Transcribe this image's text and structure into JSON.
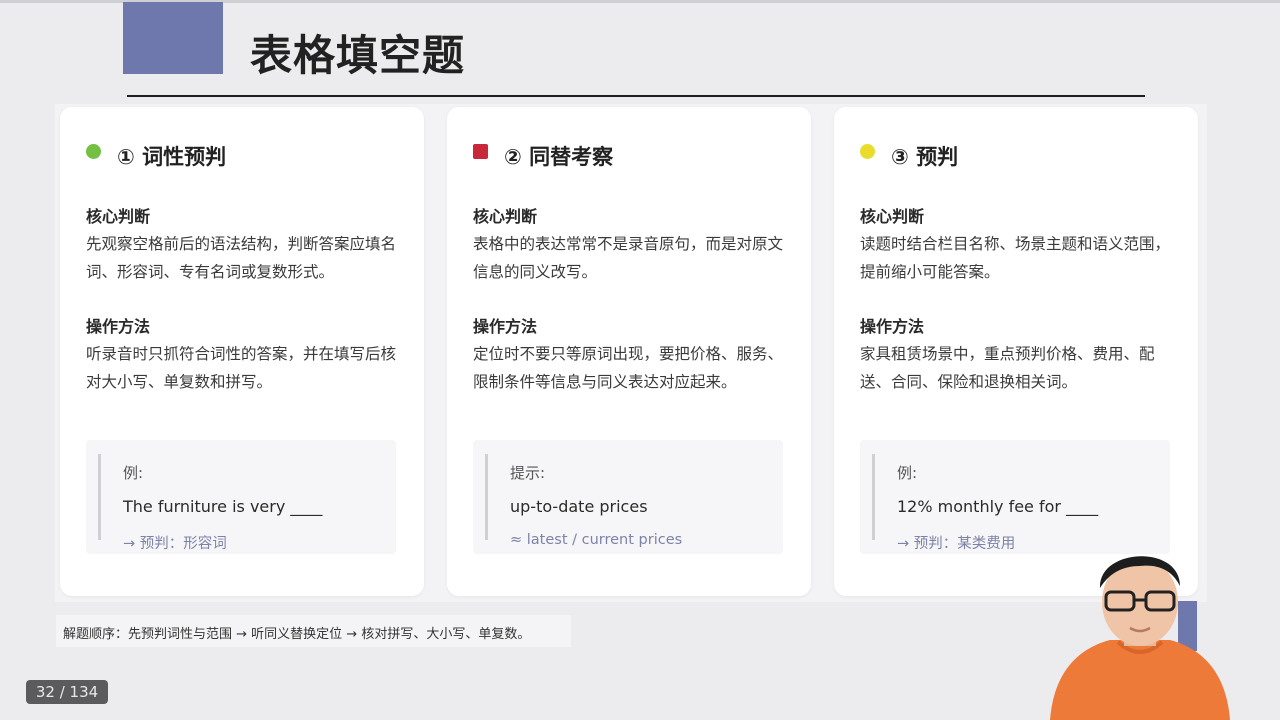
{
  "slide": {
    "title": "表格填空题"
  },
  "cards": [
    {
      "title": "① 词性预判",
      "marker_color": "#74c043",
      "core_label": "核心判断",
      "core_text": "先观察空格前后的语法结构，判断答案应填名词、形容词、专有名词或复数形式。",
      "method_label": "操作方法",
      "method_text": "听录音时只抓符合词性的答案，并在填写后核对大小写、单复数和拼写。",
      "example_label": "例:",
      "example_text": "The furniture is very ____",
      "example_note": "→ 预判：形容词"
    },
    {
      "title": "② 同替考察",
      "marker_color": "#c8283a",
      "core_label": "核心判断",
      "core_text": "表格中的表达常常不是录音原句，而是对原文信息的同义改写。",
      "method_label": "操作方法",
      "method_text": "定位时不要只等原词出现，要把价格、服务、限制条件等信息与同义表达对应起来。",
      "example_label": "提示:",
      "example_text": "up-to-date prices",
      "example_note": "≈ latest / current prices"
    },
    {
      "title": "③ 预判",
      "marker_color": "#e9dc2c",
      "core_label": "核心判断",
      "core_text": "读题时结合栏目名称、场景主题和语义范围，提前缩小可能答案。",
      "method_label": "操作方法",
      "method_text": "家具租赁场景中，重点预判价格、费用、配送、合同、保险和退换相关词。",
      "example_label": "例:",
      "example_text": "12% monthly fee for ____",
      "example_note": "→ 预判：某类费用"
    }
  ],
  "footer": {
    "note": "解题顺序：先预判词性与范围 → 听同义替换定位 → 核对拼写、大小写、单复数。"
  },
  "pager": {
    "current": "32",
    "total": "134",
    "label": "32 / 134"
  },
  "colors": {
    "accent": "#6f78ad",
    "note": "#7d82a8"
  }
}
